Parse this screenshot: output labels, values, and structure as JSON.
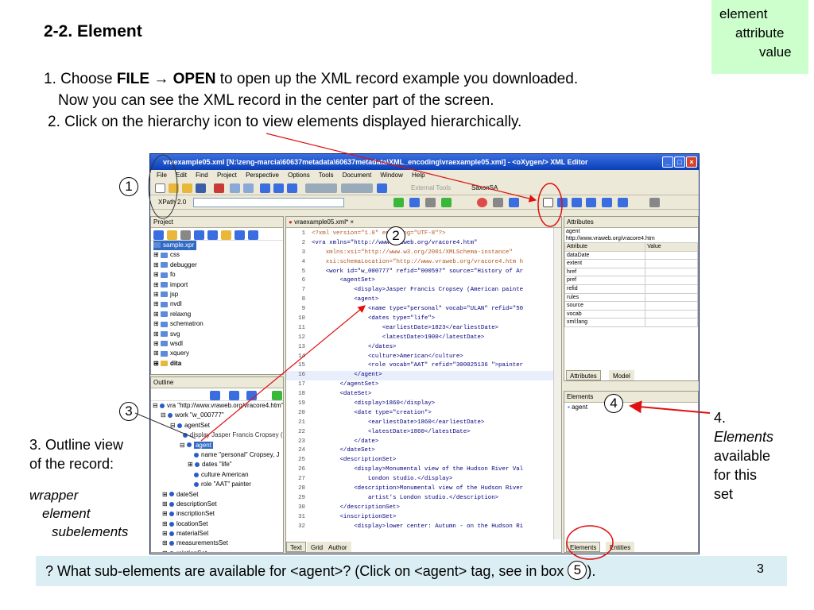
{
  "slide": {
    "title": "2-2. Element",
    "step1_prefix": "1. Choose ",
    "step1_file": "FILE",
    "step1_arrow": " → ",
    "step1_open": "OPEN",
    "step1_suffix": " to open up the XML record example you downloaded.",
    "step1_line2": "Now you can see the XML record in the center part of the screen.",
    "step2": "2. Click on the hierarchy icon to view elements displayed hierarchically.",
    "legend": [
      "element",
      "attribute",
      "value"
    ],
    "callout3": [
      "3. Outline view",
      "of the record:"
    ],
    "callout3_italic": [
      "wrapper",
      "element",
      "subelements"
    ],
    "callout4": [
      "4.",
      "Elements",
      "available",
      "for this",
      "set"
    ],
    "markers": [
      "1",
      "2",
      "3",
      "4",
      "5"
    ],
    "question_before": "? What sub-elements are available for <agent>? (Click on <agent> tag, see in box ",
    "question_after": ").",
    "page_number": "3"
  },
  "app": {
    "title": "vraexample05.xml [N:\\zeng-marcia\\60637metadata\\60637metadata\\XML_encoding\\vraexample05.xml] - <oXygen/> XML Editor",
    "menu": [
      "File",
      "Edit",
      "Find",
      "Project",
      "Perspective",
      "Options",
      "Tools",
      "Document",
      "Window",
      "Help"
    ],
    "toolbar_external_tools": "External Tools",
    "toolbar_saxon": "SaxonSA",
    "xpath_label": "XPath 2.0",
    "project_title": "Project",
    "project_items": [
      "sample.xpr",
      "css",
      "debugger",
      "fo",
      "import",
      "jsp",
      "nvdl",
      "relaxng",
      "schematron",
      "svg",
      "wsdl",
      "xquery",
      "dita"
    ],
    "outline_title": "Outline",
    "outline_items": [
      "vra \"http://www.vraweb.org/vracore4.htm\"",
      "work \"w_000777\"",
      "agentSet",
      "display Jasper Francis Cropsey (",
      "agent",
      "name \"personal\" Cropsey, J",
      "dates \"life\"",
      "culture American",
      "role \"AAT\" painter",
      "dateSet",
      "descriptionSet",
      "inscriptionSet",
      "locationSet",
      "materialSet",
      "measurementsSet",
      "relationSet"
    ],
    "editor_tab": "vraexample05.xml*",
    "code_lines": [
      "<?xml version=\"1.0\" encoding=\"UTF-8\"?>",
      "<vra xmlns=\"http://www.vraweb.org/vracore4.htm\"",
      "    xmlns:xsi=\"http://www.w3.org/2001/XMLSchema-instance\"",
      "    xsi:schemaLocation=\"http://www.vraweb.org/vracore4.htm h",
      "    <work id=\"w_000777\" refid=\"000597\" source=\"History of Ar",
      "        <agentSet>",
      "            <display>Jasper Francis Cropsey (American painte",
      "            <agent>",
      "                <name type=\"personal\" vocab=\"ULAN\" refid=\"50",
      "                <dates type=\"life\">",
      "                    <earliestDate>1823</earliestDate>",
      "                    <latestDate>1900</latestDate>",
      "                </dates>",
      "                <culture>American</culture>",
      "                <role vocab=\"AAT\" refid=\"300025136 \">painter",
      "            </agent>",
      "        </agentSet>",
      "        <dateSet>",
      "            <display>1860</display>",
      "            <date type=\"creation\">",
      "                <earliestDate>1860</earliestDate>",
      "                <latestDate>1860</latestDate>",
      "            </date>",
      "        </dateSet>",
      "        <descriptionSet>",
      "            <display>Monumental view of the Hudson River Val",
      "                London studio.</display>",
      "            <description>Monumental view of the Hudson River",
      "                artist's London studio.</description>",
      "        </descriptionSet>",
      "        <inscriptionSet>",
      "            <display>lower center: Autumn - on the Hudson Ri"
    ],
    "editor_bottom_tabs": [
      "Text",
      "Grid",
      "Author"
    ],
    "attributes_title": "Attributes",
    "attributes_context": "agent",
    "attributes_url": "http://www.vraweb.org/vracore4.htm",
    "attr_col_attribute": "Attribute",
    "attr_col_value": "Value",
    "attr_rows": [
      "dataDate",
      "extent",
      "href",
      "pref",
      "refid",
      "rules",
      "source",
      "vocab",
      "xml:lang"
    ],
    "attr_tabs": [
      "Attributes",
      "Model"
    ],
    "elements_title": "Elements",
    "elements_items": [
      "agent"
    ],
    "elements_tabs": [
      "Elements",
      "Entities"
    ]
  }
}
